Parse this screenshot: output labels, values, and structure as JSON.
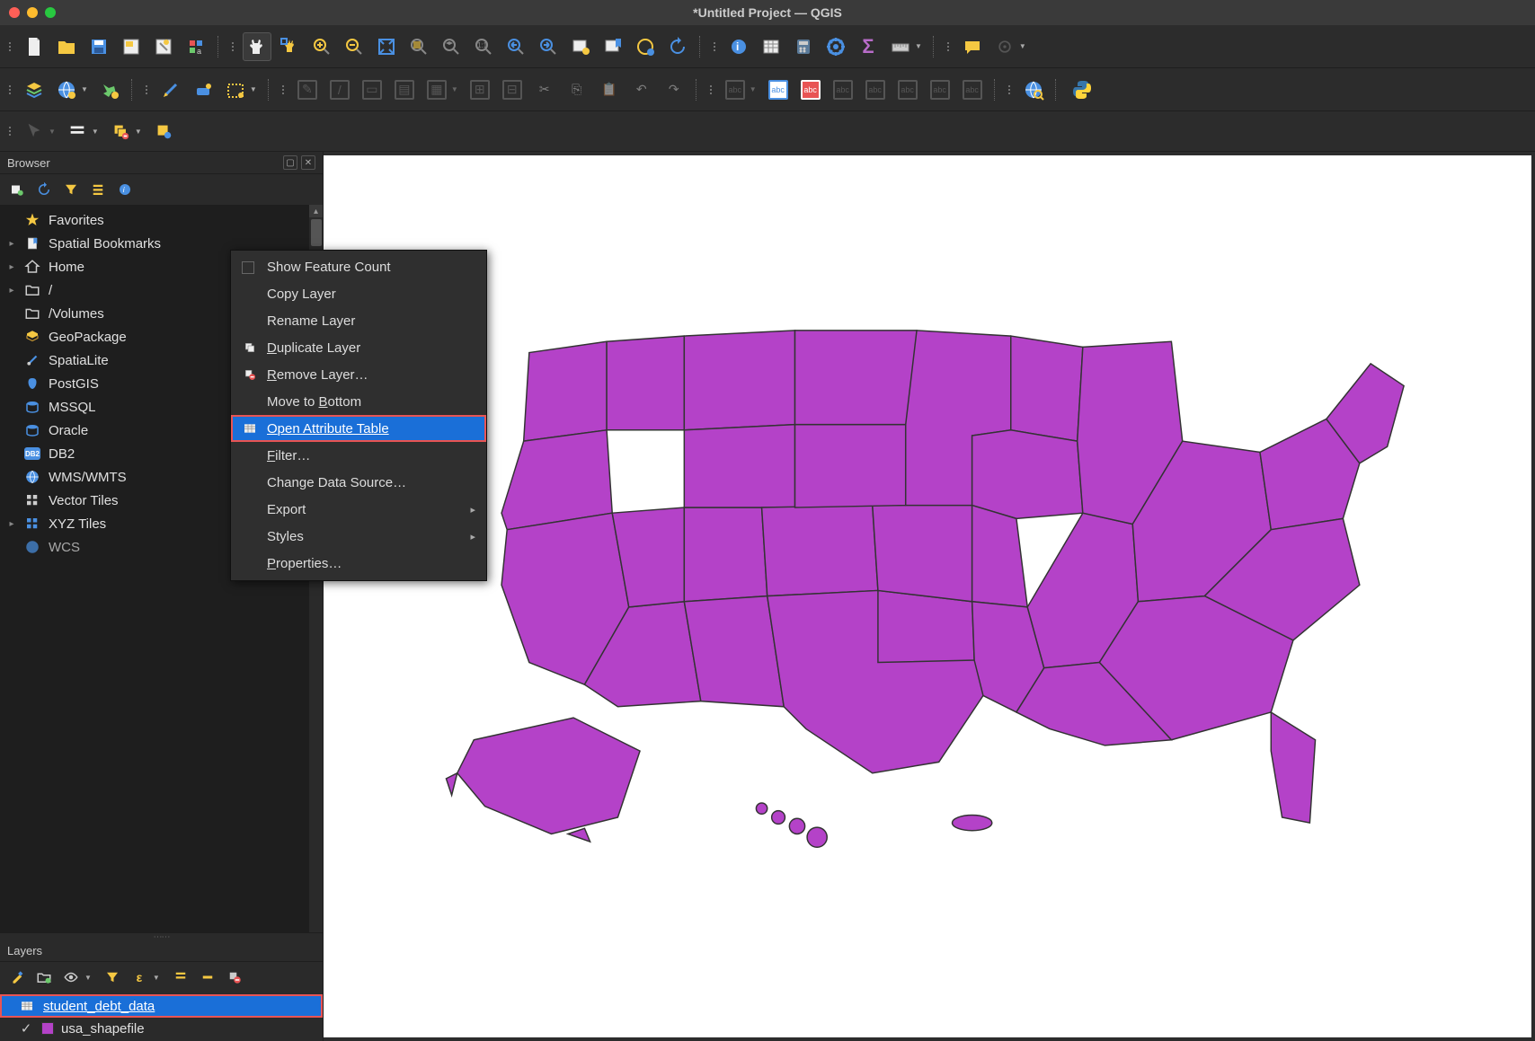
{
  "title": "*Untitled Project — QGIS",
  "panels": {
    "browser": {
      "title": "Browser",
      "items": [
        {
          "icon": "star",
          "label": "Favorites",
          "expand": ""
        },
        {
          "icon": "bookmark",
          "label": "Spatial Bookmarks",
          "expand": "▸"
        },
        {
          "icon": "home",
          "label": "Home",
          "expand": "▸"
        },
        {
          "icon": "folder",
          "label": "/",
          "expand": "▸"
        },
        {
          "icon": "folder",
          "label": "/Volumes",
          "expand": ""
        },
        {
          "icon": "geopackage",
          "label": "GeoPackage",
          "expand": ""
        },
        {
          "icon": "spatialite",
          "label": "SpatiaLite",
          "expand": ""
        },
        {
          "icon": "postgis",
          "label": "PostGIS",
          "expand": ""
        },
        {
          "icon": "mssql",
          "label": "MSSQL",
          "expand": ""
        },
        {
          "icon": "oracle",
          "label": "Oracle",
          "expand": ""
        },
        {
          "icon": "db2",
          "label": "DB2",
          "expand": ""
        },
        {
          "icon": "wms",
          "label": "WMS/WMTS",
          "expand": ""
        },
        {
          "icon": "vectortiles",
          "label": "Vector Tiles",
          "expand": ""
        },
        {
          "icon": "xyz",
          "label": "XYZ Tiles",
          "expand": "▸"
        },
        {
          "icon": "wcs",
          "label": "WCS",
          "expand": ""
        }
      ]
    },
    "layers": {
      "title": "Layers",
      "items": [
        {
          "name": "student_debt_data",
          "selected": true,
          "checked": false,
          "swatch": "none",
          "type": "table"
        },
        {
          "name": "usa_shapefile",
          "selected": false,
          "checked": true,
          "swatch": "#b442c8",
          "type": "polygon"
        }
      ]
    }
  },
  "context_menu": {
    "items": [
      {
        "label": "Show Feature Count",
        "checkbox": true
      },
      {
        "label": "Copy Layer"
      },
      {
        "label": "Rename Layer"
      },
      {
        "label": "Duplicate Layer",
        "icon": "duplicate",
        "accel": "D"
      },
      {
        "label": "Remove Layer…",
        "icon": "remove",
        "accel": "R"
      },
      {
        "label": "Move to Bottom",
        "accel": "B"
      },
      {
        "label": "Open Attribute Table",
        "icon": "table",
        "highlighted": true,
        "accel": "O"
      },
      {
        "label": "Filter…",
        "accel": "F"
      },
      {
        "label": "Change Data Source…"
      },
      {
        "label": "Export",
        "submenu": true
      },
      {
        "label": "Styles",
        "submenu": true
      },
      {
        "label": "Properties…",
        "accel": "P"
      }
    ]
  }
}
